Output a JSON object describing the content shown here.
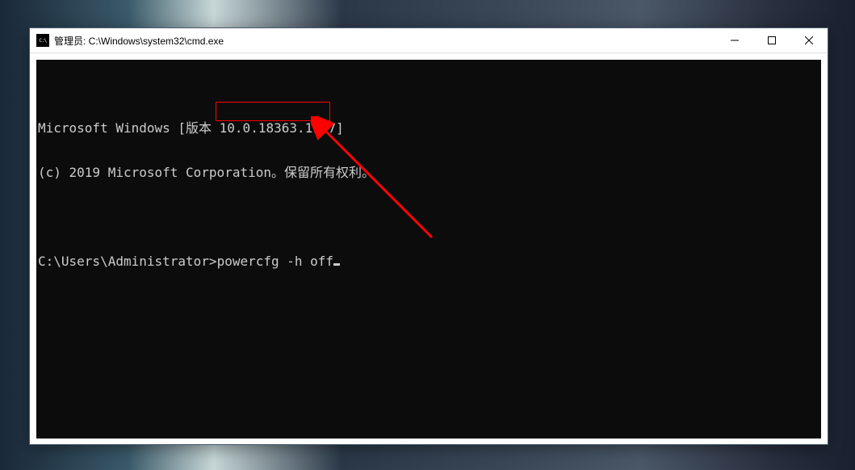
{
  "window": {
    "title": "管理员: C:\\Windows\\system32\\cmd.exe",
    "icon_label": "C:\\"
  },
  "terminal": {
    "line1": "Microsoft Windows [版本 10.0.18363.1977]",
    "line2": "(c) 2019 Microsoft Corporation。保留所有权利。",
    "prompt": "C:\\Users\\Administrator>",
    "command": "powercfg -h off"
  },
  "annotation": {
    "highlight_color": "#ff0000",
    "arrow_color": "#ff0000"
  }
}
